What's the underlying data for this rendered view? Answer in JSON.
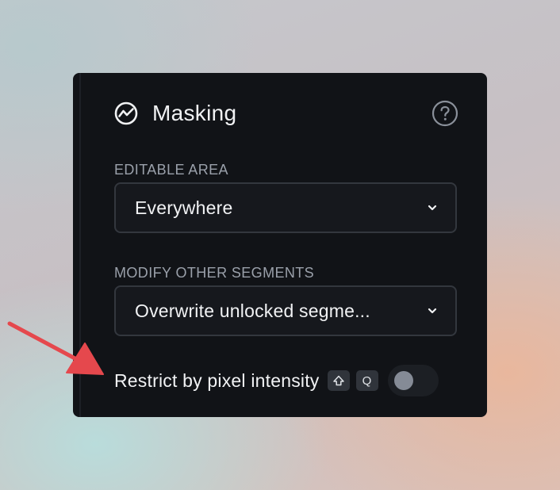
{
  "colors": {
    "panel_bg": "#111317",
    "select_border": "#33373e",
    "label_muted": "#9aa0aa",
    "text_primary": "#f1f2f4",
    "toggle_track": "#1c1f24",
    "toggle_knob": "#858b96",
    "annotation_arrow": "#e5484d"
  },
  "panel": {
    "title": "Masking",
    "title_icon": "activity-circle-icon",
    "help_icon": "question-circle-icon"
  },
  "editable_area": {
    "label": "EDITABLE AREA",
    "value": "Everywhere"
  },
  "modify_other_segments": {
    "label": "MODIFY OTHER SEGMENTS",
    "value": "Overwrite unlocked segme..."
  },
  "restrict": {
    "label": "Restrict by pixel intensity",
    "shortcut_shift_icon": "shift-key-icon",
    "shortcut_key": "Q",
    "toggle_on": false
  },
  "annotation": {
    "icon": "red-arrow-icon"
  }
}
